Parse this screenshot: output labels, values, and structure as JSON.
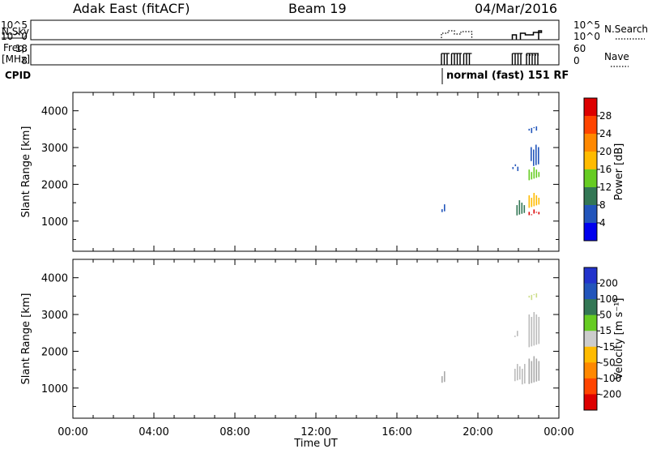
{
  "header": {
    "station": "Adak East (fitACF)",
    "beam": "Beam 19",
    "date": "04/Mar/2016"
  },
  "noise_panel": {
    "left_label": "N.Sky",
    "left_ticks": [
      "10^5",
      "10^0"
    ],
    "right_ticks": [
      "10^5",
      "10^0"
    ],
    "right_label": "N.Search"
  },
  "freq_panel": {
    "left_label_1": "Freq.",
    "left_label_2": "[MHz]",
    "left_ticks": [
      "18",
      "8"
    ],
    "right_ticks": [
      "60",
      "0"
    ],
    "right_label": "Nave",
    "cpid_label": "CPID",
    "cpid_text": "normal (fast) 151 RF"
  },
  "chart_data": [
    {
      "type": "heatmap",
      "name_axis": "Slant Range [km]",
      "ylabel": "Slant Range [km]",
      "yticks": [
        1000,
        2000,
        3000,
        4000
      ],
      "ylim": [
        180,
        4500
      ],
      "xlim": [
        0,
        24
      ],
      "colorbar_label": "Power [dB]",
      "colorbar_ticks": [
        "28",
        "24",
        "20",
        "16",
        "12",
        "8",
        "4"
      ],
      "colorbar_colors": [
        "#dd0000",
        "#ff4400",
        "#ff8800",
        "#ffbb00",
        "#66cc22",
        "#337755",
        "#2255bb",
        "#0000ee"
      ],
      "echo_clusters": [
        {
          "t_start": 18.2,
          "t_end": 18.4,
          "r_start": 1200,
          "r_end": 1500,
          "color": "#2255bb"
        },
        {
          "t_start": 21.7,
          "t_end": 22.0,
          "r_start": 2350,
          "r_end": 2600,
          "color": "#2255bb"
        },
        {
          "t_start": 21.9,
          "t_end": 22.3,
          "r_start": 1100,
          "r_end": 1600,
          "color": "#337755"
        },
        {
          "t_start": 22.5,
          "t_end": 23.0,
          "r_start": 1150,
          "r_end": 1350,
          "color": "#dd0000"
        },
        {
          "t_start": 22.5,
          "t_end": 23.0,
          "r_start": 1350,
          "r_end": 1800,
          "color": "#ffbb00"
        },
        {
          "t_start": 22.5,
          "t_end": 23.0,
          "r_start": 2100,
          "r_end": 2500,
          "color": "#66cc22"
        },
        {
          "t_start": 22.6,
          "t_end": 23.0,
          "r_start": 2500,
          "r_end": 3100,
          "color": "#2255bb"
        },
        {
          "t_start": 22.5,
          "t_end": 22.9,
          "r_start": 3500,
          "r_end": 3560,
          "color": "#2255bb"
        }
      ]
    },
    {
      "type": "heatmap",
      "ylabel": "Slant Range [km]",
      "yticks": [
        1000,
        2000,
        3000,
        4000
      ],
      "ylim": [
        180,
        4500
      ],
      "xlim": [
        0,
        24
      ],
      "xticks": [
        "00:00",
        "04:00",
        "08:00",
        "12:00",
        "16:00",
        "20:00",
        "00:00"
      ],
      "xlabel": "Time UT",
      "colorbar_label": "Velocity [m s⁻¹]",
      "colorbar_ticks": [
        "200",
        "100",
        "50",
        "15",
        "-15",
        "-50",
        "-100",
        "-200"
      ],
      "colorbar_colors": [
        "#2233cc",
        "#2255bb",
        "#337755",
        "#66cc22",
        "#cccccc",
        "#ffbb00",
        "#ff8800",
        "#ff4400",
        "#dd0000"
      ],
      "echo_clusters": [
        {
          "t_start": 18.2,
          "t_end": 18.4,
          "r_start": 1100,
          "r_end": 1500,
          "color": "#aaaaaa"
        },
        {
          "t_start": 21.8,
          "t_end": 22.3,
          "r_start": 1100,
          "r_end": 1700,
          "color": "#bbbbbb"
        },
        {
          "t_start": 21.8,
          "t_end": 22.0,
          "r_start": 2300,
          "r_end": 2600,
          "color": "#bbbbbb"
        },
        {
          "t_start": 22.5,
          "t_end": 23.0,
          "r_start": 1100,
          "r_end": 1900,
          "color": "#aaaaaa"
        },
        {
          "t_start": 22.5,
          "t_end": 23.0,
          "r_start": 2100,
          "r_end": 3100,
          "color": "#bbbbbb"
        },
        {
          "t_start": 22.5,
          "t_end": 22.9,
          "r_start": 3500,
          "r_end": 3560,
          "color": "#ccdd88"
        }
      ]
    }
  ],
  "activity": {
    "noise_blocks": [
      [
        18.2,
        19.7
      ],
      [
        21.7,
        23.0
      ]
    ],
    "freq_blocks": [
      [
        18.2,
        18.6
      ],
      [
        18.7,
        19.2
      ],
      [
        19.3,
        19.7
      ],
      [
        21.7,
        22.2
      ],
      [
        22.4,
        23.0
      ]
    ]
  }
}
